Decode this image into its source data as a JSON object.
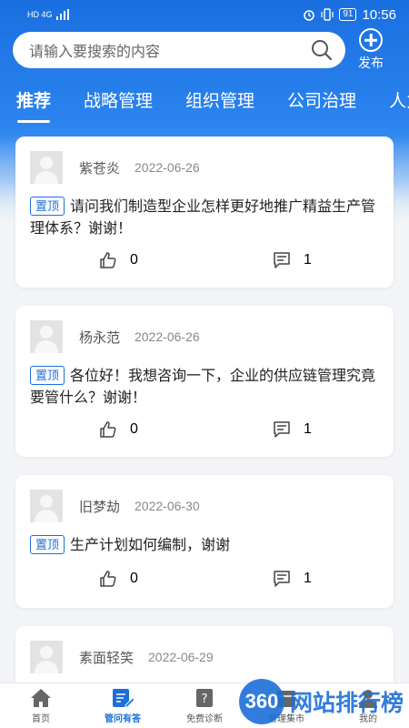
{
  "status": {
    "time": "10:56",
    "battery": "91",
    "network": "HD 4G"
  },
  "search": {
    "placeholder": "请输入要搜索的内容"
  },
  "publish_label": "发布",
  "tabs": [
    "推荐",
    "战略管理",
    "组织管理",
    "公司治理",
    "人力"
  ],
  "pin_label": "置顶",
  "posts": [
    {
      "user": "紫苍炎",
      "date": "2022-06-26",
      "text": "请问我们制造型企业怎样更好地推广精益生产管理体系？谢谢！",
      "likes": "0",
      "comments": "1"
    },
    {
      "user": "杨永范",
      "date": "2022-06-26",
      "text": "各位好！我想咨询一下，企业的供应链管理究竟要管什么？谢谢！",
      "likes": "0",
      "comments": "1"
    },
    {
      "user": "旧梦劫",
      "date": "2022-06-30",
      "text": "生产计划如何编制，谢谢",
      "likes": "0",
      "comments": "1"
    },
    {
      "user": "素面轻笑",
      "date": "2022-06-29"
    }
  ],
  "tabbar": [
    "首页",
    "管问有答",
    "免费诊断",
    "管理集市",
    "我的"
  ],
  "watermark": {
    "logo": "360",
    "text": "网站排行榜"
  },
  "colors": {
    "accent": "#1c6fd9"
  }
}
